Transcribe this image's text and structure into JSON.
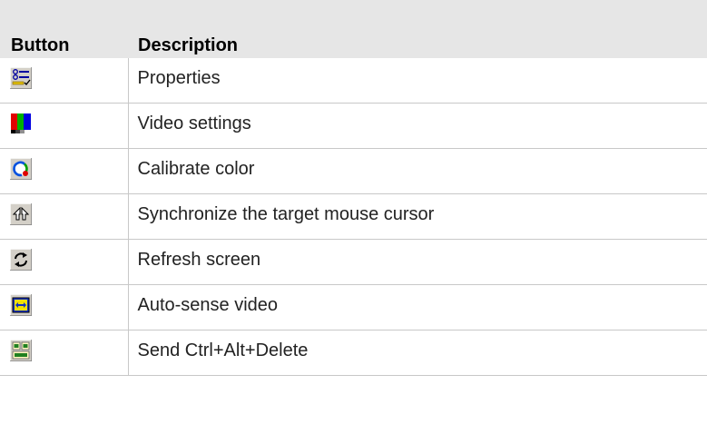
{
  "table": {
    "headers": {
      "button": "Button",
      "description": "Description"
    },
    "rows": [
      {
        "icon": "properties-icon",
        "description": "Properties"
      },
      {
        "icon": "video-settings-icon",
        "description": "Video settings"
      },
      {
        "icon": "calibrate-color-icon",
        "description": "Calibrate color"
      },
      {
        "icon": "sync-mouse-cursor-icon",
        "description": "Synchronize the target mouse cursor"
      },
      {
        "icon": "refresh-screen-icon",
        "description": "Refresh screen"
      },
      {
        "icon": "auto-sense-video-icon",
        "description": "Auto-sense video"
      },
      {
        "icon": "send-ctrl-alt-delete-icon",
        "description": "Send Ctrl+Alt+Delete"
      }
    ]
  },
  "colors": {
    "header_background": "#e6e6e6",
    "button_face": "#d4d0c8",
    "grid_line": "#c8c8c8"
  }
}
